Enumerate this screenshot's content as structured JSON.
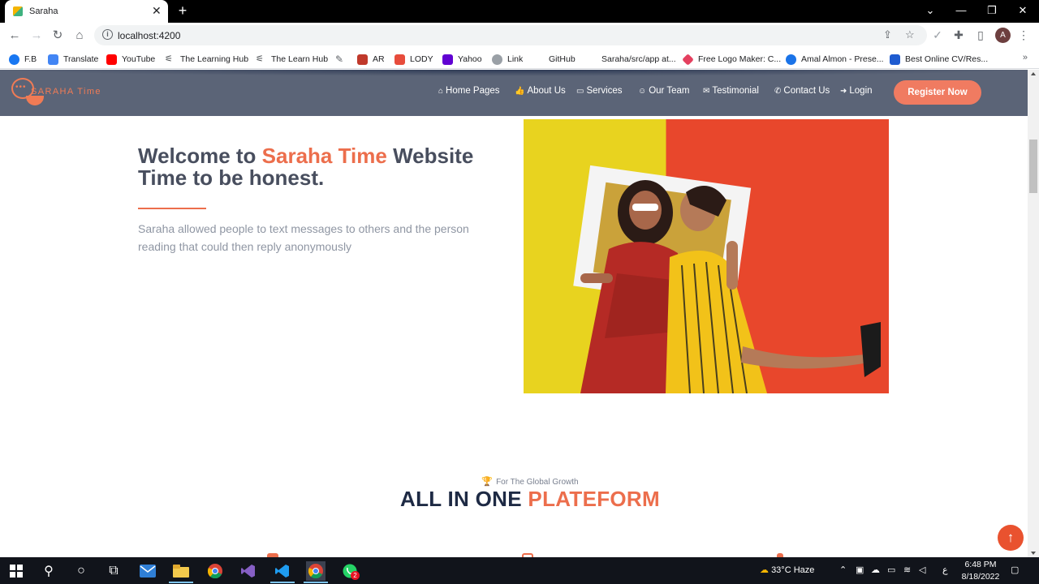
{
  "browser": {
    "tab_title": "Saraha",
    "tab_close": "✕",
    "new_tab": "+",
    "url": "localhost:4200",
    "avatar_letter": "A",
    "window_controls": {
      "minimize": "—",
      "maximize": "❐",
      "close": "✕",
      "tab_search": "⌄"
    }
  },
  "bookmarks": [
    {
      "label": "F.B",
      "color": "#1877f2"
    },
    {
      "label": "Translate",
      "color": "#4285f4"
    },
    {
      "label": "YouTube",
      "color": "#ff0000"
    },
    {
      "label": "The Learning Hub",
      "color": "#3c4043"
    },
    {
      "label": "The Learn Hub",
      "color": "#3c4043"
    },
    {
      "label": "",
      "color": "#5f6368"
    },
    {
      "label": "AR",
      "color": "#c0392b"
    },
    {
      "label": "LODY",
      "color": "#e74c3c"
    },
    {
      "label": "Yahoo",
      "color": "#6001d2"
    },
    {
      "label": "Link",
      "color": "#9aa0a6"
    },
    {
      "label": "GitHub",
      "color": "#ffffff"
    },
    {
      "label": "Saraha/src/app at...",
      "color": "#ffffff"
    },
    {
      "label": "Free Logo Maker: C...",
      "color": "#e4405f"
    },
    {
      "label": "Amal Almon - Prese...",
      "color": "#1a73e8"
    },
    {
      "label": "Best Online CV/Res...",
      "color": "#1e5bd0"
    }
  ],
  "bookmarks_more": "»",
  "site": {
    "logo_text": "SARAHA Time",
    "nav": [
      {
        "icon": "⌂",
        "label": "Home Pages"
      },
      {
        "icon": "👍",
        "label": "About Us"
      },
      {
        "icon": "▭",
        "label": "Services"
      },
      {
        "icon": "☺",
        "label": "Our Team"
      },
      {
        "icon": "✉",
        "label": "Testimonial"
      },
      {
        "icon": "✆",
        "label": "Contact Us"
      },
      {
        "icon": "➜",
        "label": "Login"
      }
    ],
    "register_label": "Register Now"
  },
  "hero": {
    "title_part1": "Welcome to ",
    "title_accent": "Saraha Time",
    "title_part2": " Website",
    "title_line2": "Time to be honest.",
    "description": "Saraha allowed people to text messages to others and the person reading that could then reply anonymously"
  },
  "section": {
    "kicker": "For The Global Growth",
    "title_part1": "ALL IN ONE ",
    "title_accent": "PLATEFORM"
  },
  "scroll_top_icon": "↑",
  "taskbar": {
    "weather": "33°C  Haze",
    "lang": "ع",
    "time": "6:48 PM",
    "date": "8/18/2022",
    "whatsapp_badge": "2"
  },
  "colors": {
    "accent": "#ec6e4c",
    "nav_bg": "#5b6477",
    "heading": "#1e2a44"
  }
}
